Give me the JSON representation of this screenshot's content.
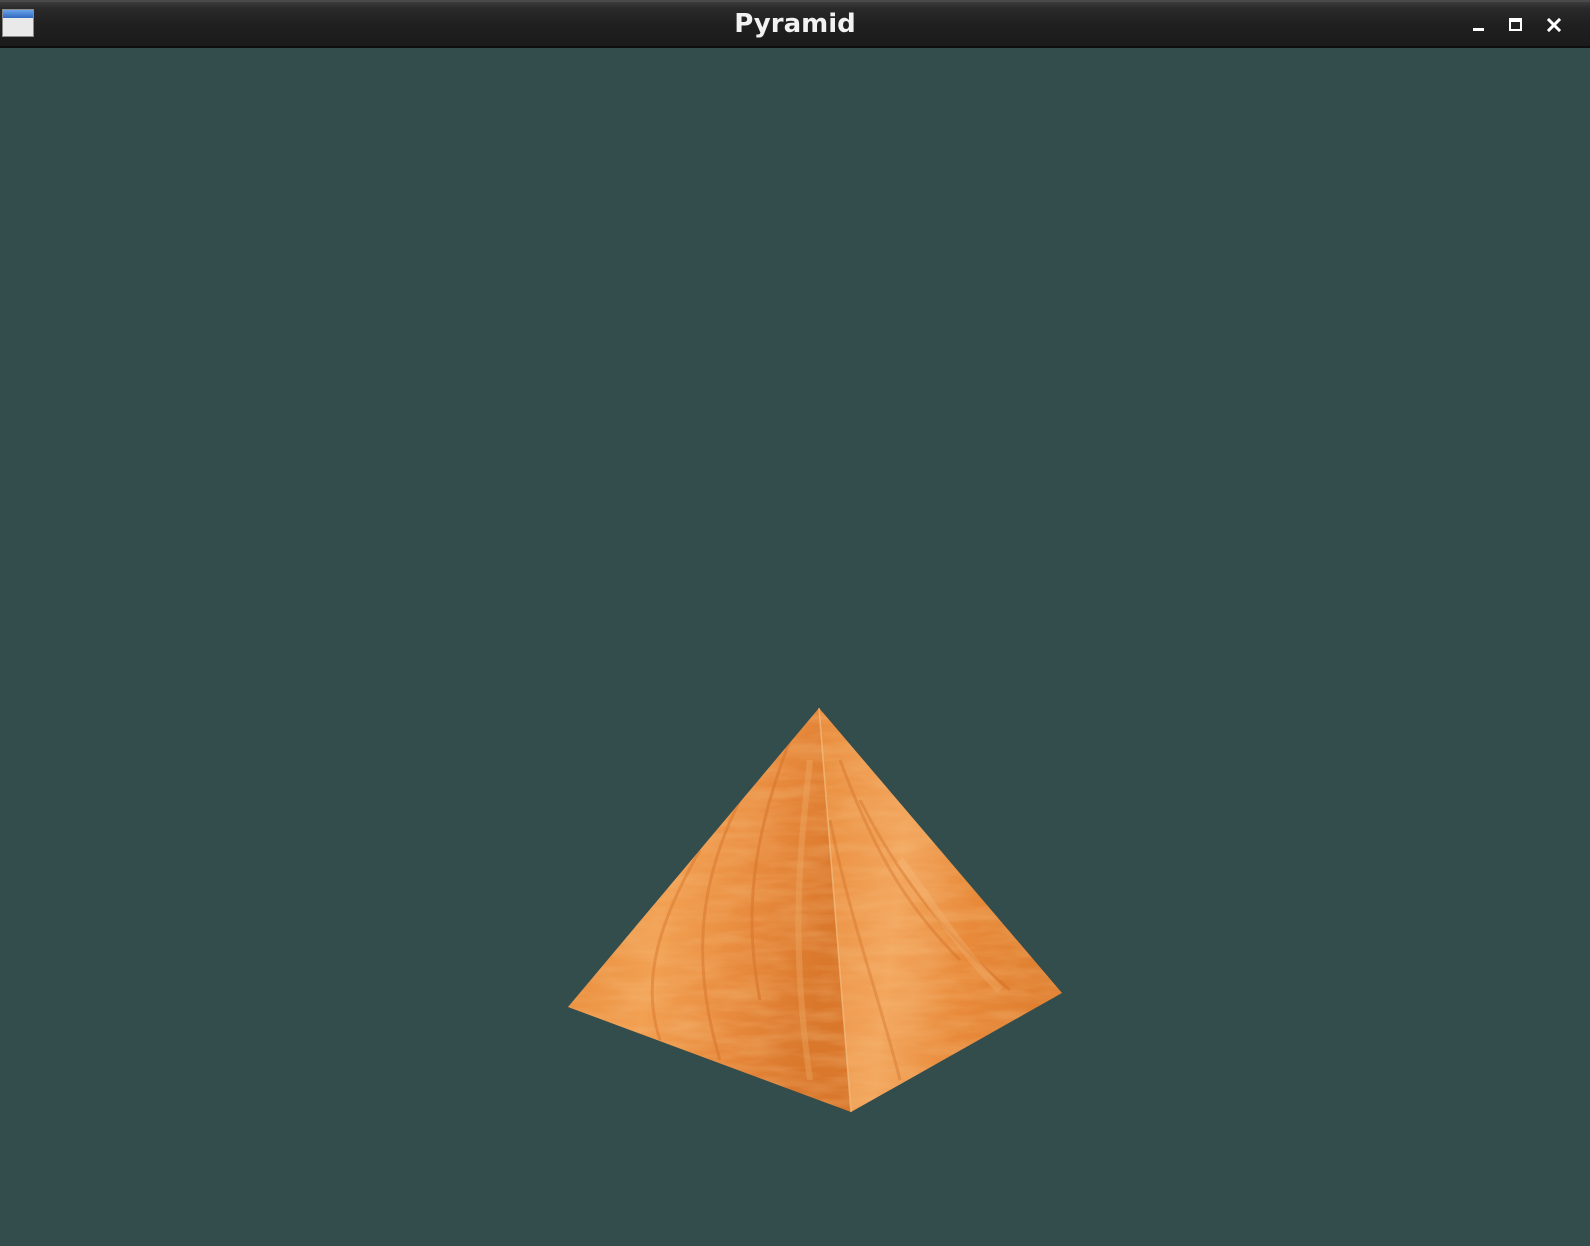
{
  "window": {
    "title": "Pyramid",
    "icon": "app-window-icon",
    "controls": [
      {
        "name": "minimize",
        "icon": "minimize-icon"
      },
      {
        "name": "maximize",
        "icon": "maximize-icon"
      },
      {
        "name": "close",
        "icon": "close-icon"
      }
    ]
  },
  "scene": {
    "background_color": "#334c4c",
    "object": "pyramid",
    "texture": "wood",
    "texture_colors": [
      "#e8873a",
      "#f3a45a",
      "#c96a22",
      "#f7b877"
    ]
  }
}
